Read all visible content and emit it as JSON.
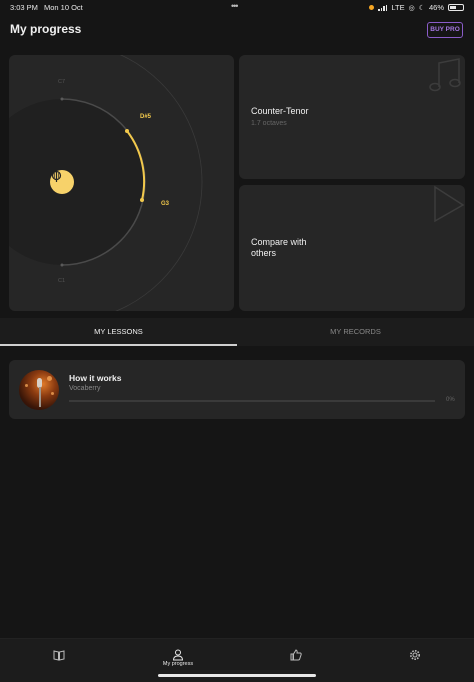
{
  "status_bar": {
    "time": "3:03 PM",
    "date": "Mon 10 Oct",
    "network": "LTE",
    "battery": "46%"
  },
  "header": {
    "title": "My progress",
    "buy_pro_label": "BUY PRO"
  },
  "range_card": {
    "top_note": "C7",
    "bottom_note": "C1",
    "high_note": "D#5",
    "low_note": "G3",
    "accent_color": "#f2c94c",
    "icon": "microphone-icon"
  },
  "voice_card": {
    "voice_type": "Counter-Tenor",
    "range": "1.7 octaves",
    "icon": "music-note-icon"
  },
  "compare_card": {
    "label": "Compare with others",
    "icon": "play-triangle-icon"
  },
  "tabs": {
    "lessons": "MY LESSONS",
    "records": "MY RECORDS",
    "active": "lessons"
  },
  "lessons": [
    {
      "title": "How it works",
      "author": "Vocaberry",
      "progress_label": "0%",
      "progress": 0
    }
  ],
  "bottom_nav": {
    "progress_label": "My progress",
    "items": [
      "book-icon",
      "person-icon",
      "thumbs-up-icon",
      "gear-icon"
    ]
  },
  "colors": {
    "background": "#151515",
    "card": "#262626",
    "accent": "#f2c94c",
    "pro": "#a577e0"
  }
}
